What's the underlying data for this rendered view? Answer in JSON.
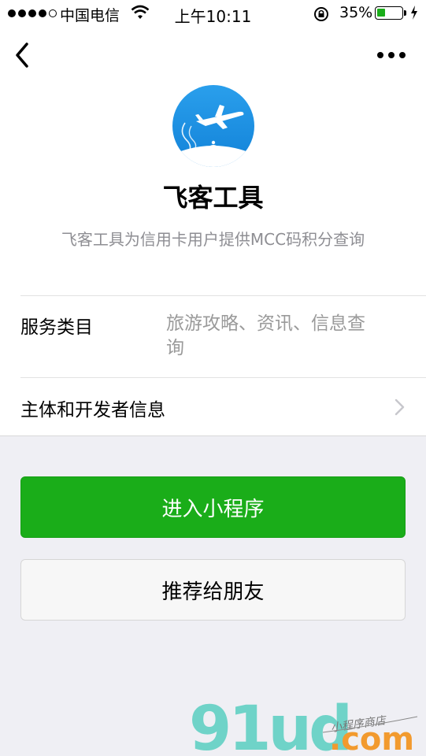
{
  "status_bar": {
    "carrier": "中国电信",
    "time": "上午10:11",
    "battery": "35%",
    "battery_level": 0.35
  },
  "nav": {
    "back_icon": "chevron-left-icon",
    "more_icon": "more-dots-icon"
  },
  "app": {
    "name": "飞客工具",
    "description": "飞客工具为信用卡用户提供MCC码积分查询",
    "logo_color": "#1a8fe3"
  },
  "info": {
    "category_label": "服务类目",
    "category_value_line1": "旅游攻略、资讯、信息查",
    "category_value_line2": "询",
    "developer_label": "主体和开发者信息"
  },
  "buttons": {
    "enter": "进入小程序",
    "recommend": "推荐给朋友"
  },
  "watermark": {
    "main": "91ud",
    "domain": ".com",
    "slogan": "小程序商店"
  },
  "colors": {
    "primary": "#1aad19",
    "background": "#efeff4"
  }
}
